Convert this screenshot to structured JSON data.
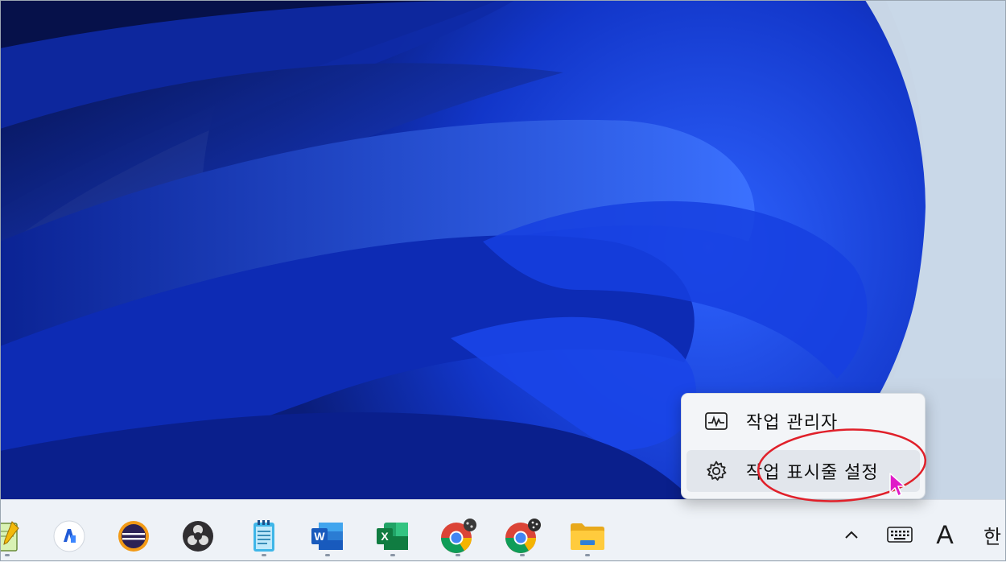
{
  "context_menu": {
    "items": [
      {
        "label": "작업 관리자",
        "icon": "task-manager-icon"
      },
      {
        "label": "작업 표시줄 설정",
        "icon": "gear-icon"
      }
    ]
  },
  "taskbar": {
    "apps": [
      {
        "name": "notepad-plus",
        "icon": "notepad-icon"
      },
      {
        "name": "app-blue-circle",
        "icon": "app-icon"
      },
      {
        "name": "eclipse",
        "icon": "eclipse-icon"
      },
      {
        "name": "obs-studio",
        "icon": "obs-icon"
      },
      {
        "name": "notepad",
        "icon": "notepad-icon"
      },
      {
        "name": "word",
        "icon": "word-icon",
        "letter": "W"
      },
      {
        "name": "excel",
        "icon": "excel-icon",
        "letter": "X"
      },
      {
        "name": "chrome-1",
        "icon": "chrome-icon"
      },
      {
        "name": "chrome-2",
        "icon": "chrome-icon"
      },
      {
        "name": "file-explorer",
        "icon": "folder-icon"
      }
    ],
    "tray": {
      "chevron": "^",
      "ime_mode": "A",
      "ime_lang": "한"
    }
  },
  "colors": {
    "wallpaper_deep": "#0a1a6a",
    "wallpaper_bright": "#1e4cff",
    "menu_bg": "#f3f5f8",
    "highlight": "#e0202a"
  }
}
